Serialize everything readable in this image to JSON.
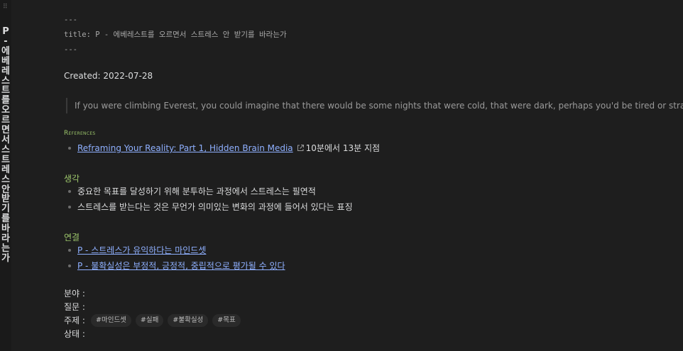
{
  "note_title_vertical": "P - 에베레스트를 오르면서 스트레스 안 받기를 바라는가",
  "frontmatter": {
    "open": "---",
    "title_line": "title: P - 에베레스트를 오르면서 스트레스 안 받기를 바라는가",
    "close": "---"
  },
  "created": "Created: 2022-07-28",
  "quote": "If you were climbing Everest, you could imagine that there would be some nights that were cold, that were dark, perhaps you'd be tired or strained.",
  "references": {
    "heading": "References",
    "items": [
      {
        "link_text": "Reframing Your Reality: Part 1, Hidden Brain Media",
        "suffix": "10분에서 13분 지점"
      }
    ]
  },
  "thoughts": {
    "heading": "생각",
    "items": [
      "중요한 목표를 달성하기 위해 분투하는 과정에서 스트레스는 필연적",
      "스트레스를 받는다는 것은 무언가 의미있는 변화의 과정에 들어서 있다는 표징"
    ]
  },
  "connections": {
    "heading": "연결",
    "items": [
      "P - 스트레스가 유익하다는 마인드셋",
      "P - 불확실성은 부정적, 긍정적, 중립적으로 평가될 수 있다"
    ]
  },
  "metadata": {
    "field_label": "분야 :",
    "question_label": "질문 :",
    "topic_label": "주제 :",
    "status_label": "상태 :",
    "tags": [
      "#마인드셋",
      "#실패",
      "#불확실성",
      "#목표"
    ]
  },
  "colors": {
    "background": "#1e1e1e",
    "heading_green": "#9bc46a",
    "link_blue": "#8fb0ff"
  },
  "icons": {
    "drag": "drag-handle-icon",
    "external": "external-link-icon"
  }
}
